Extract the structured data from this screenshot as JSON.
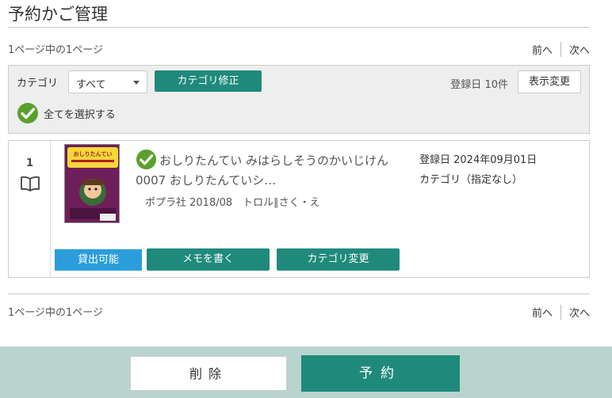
{
  "page": {
    "title": "予約かご管理"
  },
  "pager": {
    "text": "1ページ中の1ページ",
    "prev_label": "前へ",
    "next_label": "次へ"
  },
  "toolbar": {
    "category_label": "カテゴリ",
    "category_selected": "すべて",
    "category_fix_label": "カテゴリ修正",
    "sort_label": "登録日",
    "count_label": "10件",
    "view_change_label": "表示変更",
    "select_all_label": "全てを選択する"
  },
  "items": [
    {
      "index": "1",
      "title": "おしりたんてい みはらしそうのかいじけん 0007 おしりたんていシ…",
      "meta": "ポプラ社 2018/08　トロル∥さく・え",
      "registered": "登録日 2024年09月01日",
      "category": "カテゴリ（指定なし）",
      "status": "貸出可能",
      "memo_label": "メモを書く",
      "category_change_label": "カテゴリ変更",
      "cover_title": "おしりたんてい"
    }
  ],
  "footer": {
    "delete_label": "削除",
    "reserve_label": "予約"
  },
  "colors": {
    "accent": "#1f8a7c",
    "status": "#2b9ddb",
    "check": "#5aa02c",
    "footer_bg": "#b9d4cf"
  },
  "icons": {
    "check": "check-circle-icon",
    "book": "open-book-icon",
    "dropdown": "chevron-down-icon"
  }
}
